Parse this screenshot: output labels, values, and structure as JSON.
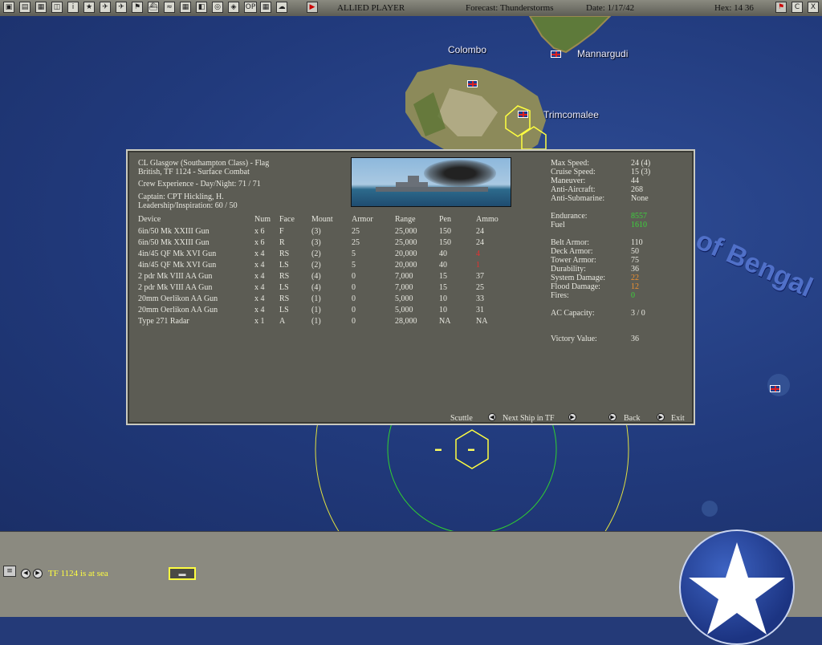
{
  "topbar": {
    "player": "ALLIED PLAYER",
    "forecast": "Forecast: Thunderstorms",
    "date": "Date: 1/17/42",
    "hex": "Hex: 14 36",
    "buttons": [
      "map-icon",
      "report-icon",
      "list-icon",
      "air-icon",
      "info-icon",
      "star-icon",
      "plane-icon",
      "plane2-icon",
      "flag-icon",
      "ship-icon",
      "routes-icon",
      "fleet-icon",
      "units-icon",
      "globe-icon",
      "zone-icon",
      "op-icon",
      "grid-icon",
      "cloud-icon"
    ],
    "op_label": "OP",
    "right_buttons": [
      "flag-icon",
      "c-icon",
      "x-icon"
    ],
    "right_labels": [
      "",
      "C",
      "X"
    ]
  },
  "map": {
    "labels": [
      "Colombo",
      "Mannargudi",
      "Trimcomalee",
      "of Bengal"
    ]
  },
  "ship": {
    "name_line": "CL Glasgow (Southampton Class) - Flag",
    "tf_line": "British, TF 1124 - Surface Combat",
    "crew_line": "Crew Experience - Day/Night:  71 / 71",
    "captain_line": "Captain: CPT Hickling, H.",
    "leadership_line": "Leadership/Inspiration: 60 / 50"
  },
  "weapons": {
    "headers": [
      "Device",
      "Num",
      "Face",
      "Mount",
      "Armor",
      "Range",
      "Pen",
      "Ammo"
    ],
    "rows": [
      [
        "6in/50 Mk XXIII Gun",
        "x 6",
        "F",
        "(3)",
        "25",
        "25,000",
        "150",
        "24"
      ],
      [
        "6in/50 Mk XXIII Gun",
        "x 6",
        "R",
        "(3)",
        "25",
        "25,000",
        "150",
        "24"
      ],
      [
        "4in/45 QF Mk XVI Gun",
        "x 4",
        "RS",
        "(2)",
        "5",
        "20,000",
        "40",
        "4"
      ],
      [
        "4in/45 QF Mk XVI Gun",
        "x 4",
        "LS",
        "(2)",
        "5",
        "20,000",
        "40",
        "1"
      ],
      [
        "2 pdr Mk VIII AA Gun",
        "x 4",
        "RS",
        "(4)",
        "0",
        "7,000",
        "15",
        "37"
      ],
      [
        "2 pdr Mk VIII AA Gun",
        "x 4",
        "LS",
        "(4)",
        "0",
        "7,000",
        "15",
        "25"
      ],
      [
        "20mm Oerlikon AA Gun",
        "x 4",
        "RS",
        "(1)",
        "0",
        "5,000",
        "10",
        "33"
      ],
      [
        "20mm Oerlikon AA Gun",
        "x 4",
        "LS",
        "(1)",
        "0",
        "5,000",
        "10",
        "31"
      ],
      [
        "Type 271 Radar",
        "x 1",
        "A",
        "(1)",
        "0",
        "28,000",
        "NA",
        "NA"
      ]
    ],
    "ammo_colors": [
      "#e8e8e0",
      "#e8e8e0",
      "#e83030",
      "#e83030",
      "#e8e8e0",
      "#e8e8e0",
      "#e8e8e0",
      "#e8e8e0",
      "#e8e8e0"
    ]
  },
  "stats": [
    {
      "label": "Max Speed:",
      "value": "24 (4)",
      "color": "#e8e8e0"
    },
    {
      "label": "Cruise Speed:",
      "value": "15 (3)",
      "color": "#e8e8e0"
    },
    {
      "label": "Maneuver:",
      "value": "44",
      "color": "#e8e8e0"
    },
    {
      "label": "Anti-Aircraft:",
      "value": "268",
      "color": "#e8e8e0"
    },
    {
      "label": "Anti-Submarine:",
      "value": "None",
      "color": "#e8e8e0"
    },
    {
      "label": "Endurance:",
      "value": "8557",
      "color": "#3cd43c"
    },
    {
      "label": "Fuel",
      "value": "1610",
      "color": "#3cd43c"
    },
    {
      "label": "Belt Armor:",
      "value": "110",
      "color": "#e8e8e0"
    },
    {
      "label": "Deck Armor:",
      "value": "50",
      "color": "#e8e8e0"
    },
    {
      "label": "Tower Armor:",
      "value": "75",
      "color": "#e8e8e0"
    },
    {
      "label": "Durability:",
      "value": "36",
      "color": "#e8e8e0"
    },
    {
      "label": "System Damage:",
      "value": "22",
      "color": "#f09030"
    },
    {
      "label": "Flood Damage:",
      "value": "12",
      "color": "#f09030"
    },
    {
      "label": "Fires:",
      "value": "0",
      "color": "#3cd43c"
    },
    {
      "label": "AC Capacity:",
      "value": "3 / 0",
      "color": "#e8e8e0"
    },
    {
      "label": "Victory Value:",
      "value": "36",
      "color": "#e8e8e0"
    }
  ],
  "dialog_buttons": {
    "scuttle": "Scuttle",
    "next_ship": "Next Ship in TF",
    "back": "Back",
    "exit": "Exit"
  },
  "bottom": {
    "status": "TF 1124 is at sea"
  }
}
